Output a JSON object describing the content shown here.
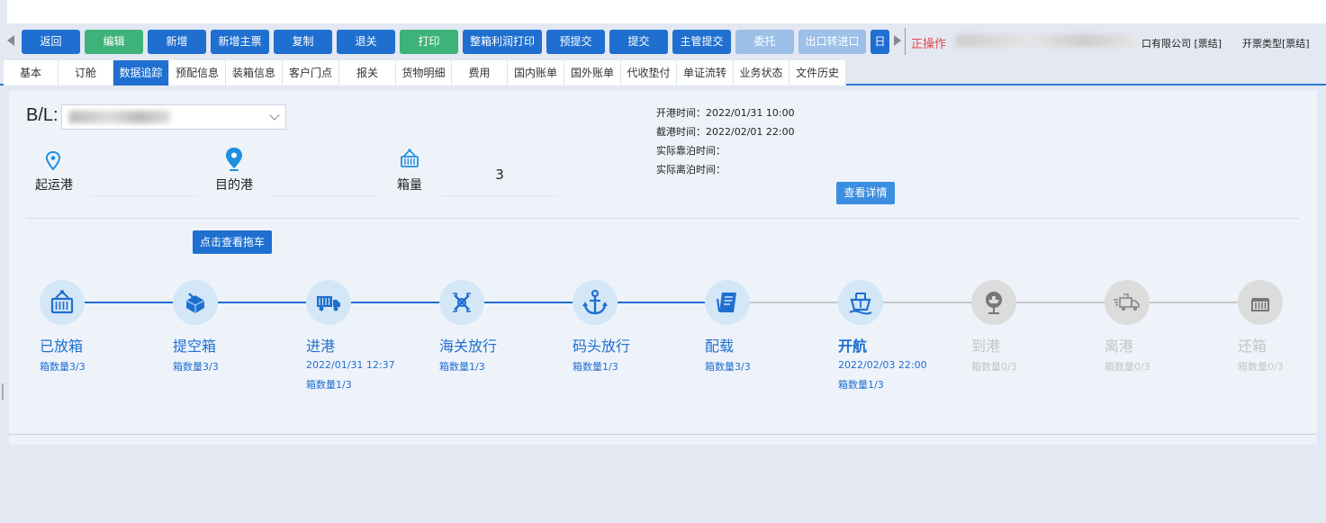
{
  "toolbar": {
    "buttons": [
      {
        "label": "返回"
      },
      {
        "label": "编辑"
      },
      {
        "label": "新增"
      },
      {
        "label": "新增主票"
      },
      {
        "label": "复制"
      },
      {
        "label": "退关"
      },
      {
        "label": "打印"
      },
      {
        "label": "整箱利润打印"
      },
      {
        "label": "预提交"
      },
      {
        "label": "提交"
      },
      {
        "label": "主管提交"
      },
      {
        "label": "委托"
      },
      {
        "label": "出口转进口"
      },
      {
        "label": "日"
      }
    ],
    "status_operating": "正操作",
    "status_company": "口有限公司 [票结]",
    "status_invoice_type": "开票类型[票结]"
  },
  "tabs": [
    "基本",
    "订舱",
    "数据追踪",
    "预配信息",
    "装箱信息",
    "客户门点",
    "报关",
    "货物明细",
    "费用",
    "国内账单",
    "国外账单",
    "代收垫付",
    "单证流转",
    "业务状态",
    "文件历史"
  ],
  "active_tab": "数据追踪",
  "bl": {
    "label": "B/L:"
  },
  "info": {
    "origin_label": "起运港",
    "dest_label": "目的港",
    "qty_label": "箱量",
    "qty_value": "3"
  },
  "times": {
    "open_label": "开港时间：",
    "open_value": "2022/01/31 10:00",
    "cutoff_label": "截港时间：",
    "cutoff_value": "2022/02/01 22:00",
    "berth_label": "实际靠泊时间：",
    "depart_label": "实际离泊时间："
  },
  "detail_button": "查看详情",
  "truck_button": "点击查看拖车",
  "stages": [
    {
      "name": "已放箱",
      "date": "",
      "count": "箱数量3/3",
      "icon": "container-crane-icon",
      "state": "done"
    },
    {
      "name": "提空箱",
      "date": "",
      "count": "箱数量3/3",
      "icon": "empty-box-icon",
      "state": "done"
    },
    {
      "name": "进港",
      "date": "2022/01/31 12:37",
      "count": "箱数量1/3",
      "icon": "truck-icon",
      "state": "done"
    },
    {
      "name": "海关放行",
      "date": "",
      "count": "箱数量1/3",
      "icon": "customs-release-icon",
      "state": "done"
    },
    {
      "name": "码头放行",
      "date": "",
      "count": "箱数量1/3",
      "icon": "anchor-icon",
      "state": "done"
    },
    {
      "name": "配载",
      "date": "",
      "count": "箱数量3/3",
      "icon": "stowage-icon",
      "state": "done"
    },
    {
      "name": "开航",
      "date": "2022/02/03 22:00",
      "count": "箱数量1/3",
      "icon": "ship-icon",
      "state": "current"
    },
    {
      "name": "到港",
      "date": "",
      "count": "箱数量0/3",
      "icon": "arrival-icon",
      "state": "todo"
    },
    {
      "name": "离港",
      "date": "",
      "count": "箱数量0/3",
      "icon": "departure-truck-icon",
      "state": "todo"
    },
    {
      "name": "还箱",
      "date": "",
      "count": "箱数量0/3",
      "icon": "return-box-icon",
      "state": "todo"
    }
  ],
  "colors": {
    "primary": "#1f6fd0",
    "green": "#3db37a",
    "disabled": "#9cc0e8",
    "done_track": "#1f6fd0",
    "todo_track": "#c8c8c8",
    "warning_text": "#e04848"
  }
}
